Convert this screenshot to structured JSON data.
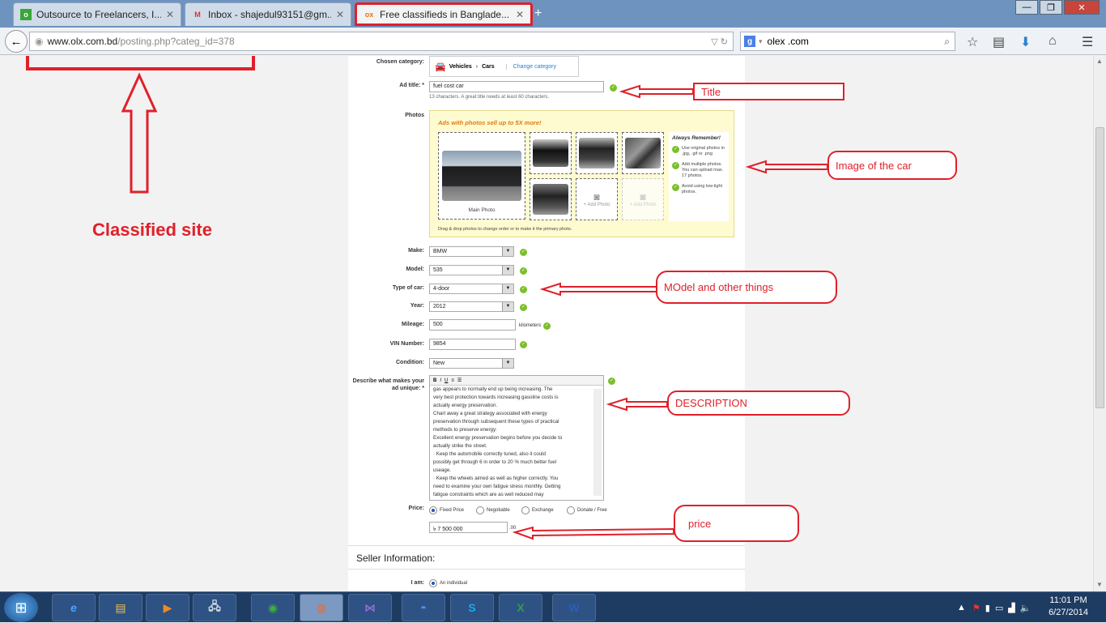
{
  "browser": {
    "tabs": [
      {
        "title": "Outsource to Freelancers, I...",
        "icon": "freelancer-icon"
      },
      {
        "title": "Inbox - shajedul93151@gm...",
        "icon": "gmail-icon"
      },
      {
        "title": "Free classifieds in Banglade...",
        "icon": "olx-icon"
      }
    ],
    "url_host": "www.olx.com.bd",
    "url_rest": "/posting.php?categ_id=378",
    "search_value": "olex .com"
  },
  "form": {
    "chosen_category_label": "Chosen category:",
    "category_vehicles": "Vehicles",
    "category_sep": "›",
    "category_cars": "Cars",
    "change_category": "Change category",
    "ad_title_label": "Ad title: *",
    "ad_title_value": "fuel cost car",
    "ad_title_hint": "13 characters. A great title needs at least 60 characters.",
    "photos_label": "Photos",
    "photos_banner": "Ads with photos sell up to 5X more!",
    "main_photo": "Main Photo",
    "add_photo": "+ Add Photo",
    "always_remember": "Always Remember!",
    "tips": [
      "Use original photos in .jpg, .gif or .png",
      "Add multiple photos. You can upload max. 17 photos.",
      "Avoid using low-light photos."
    ],
    "drag_hint": "Drag & drop photos to change order or to make it the primary photo.",
    "make_label": "Make:",
    "make_value": "BMW",
    "model_label": "Model:",
    "model_value": "535",
    "type_label": "Type of car:",
    "type_value": "4-door",
    "year_label": "Year:",
    "year_value": "2012",
    "mileage_label": "Mileage:",
    "mileage_value": "500",
    "mileage_unit": "kilometers",
    "vin_label": "VIN Number:",
    "vin_value": "9854",
    "condition_label": "Condition:",
    "condition_value": "New",
    "desc_label": "Describe what makes your ad unique: *",
    "desc_lines": [
      "gas appears to normally end up being increasing. The",
      "very best protection towards increasing gasoline costs is",
      "actually energy preservation.",
      "Chart away a great strategy associated with energy",
      "preservation through subsequent these types of practical",
      "methods to preserve energy:",
      "Excellent energy preservation begins before you decide to",
      "actually strike the street.",
      "· Keep the automobile correctly tuned, also it could",
      "possibly get through 6 in order to 20 % much better fuel",
      "useage.",
      "· Keep the wheels aimed as well as higher correctly. You",
      "need to examine your own fatigue stress monthly. Getting",
      "fatigue constraints which are as well reduced may"
    ],
    "price_label": "Price:",
    "price_options": [
      "Fixed Price",
      "Negotiable",
      "Exchange",
      "Donate / Free"
    ],
    "price_value": "৳ 7 500 000",
    "price_suffix": ".00",
    "seller_info": "Seller Information:",
    "i_am_label": "I am:",
    "i_am_value": "An individual"
  },
  "annotations": {
    "classified_site": "Classified site",
    "title": "Title",
    "image": "Image of the car",
    "model": "MOdel and other things",
    "description": "DESCRIPTION",
    "price": "price"
  },
  "taskbar": {
    "time": "11:01 PM",
    "date": "6/27/2014"
  },
  "colors": {
    "annotation_red": "#e0202a",
    "ok_green": "#7bbf2a",
    "photo_bg": "#fffbd0"
  }
}
